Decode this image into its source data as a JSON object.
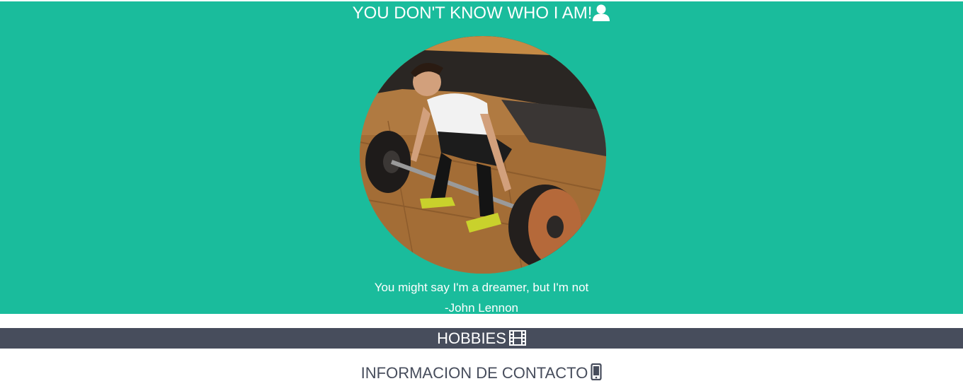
{
  "hero": {
    "title": "YOU DON'T KNOW WHO I AM!",
    "title_icon": "person-icon",
    "photo_alt": "Man lifting barbell deadlift",
    "quote": "You might say I'm a dreamer, but I'm not",
    "author": "-John Lennon",
    "background": "#1abc9c"
  },
  "sections": {
    "hobbies": {
      "label": "HOBBIES",
      "icon": "film-icon",
      "background": "#474d5c"
    },
    "contact": {
      "label": "INFORMACION DE CONTACTO",
      "icon": "mobile-phone-icon",
      "color": "#474d5c"
    }
  }
}
